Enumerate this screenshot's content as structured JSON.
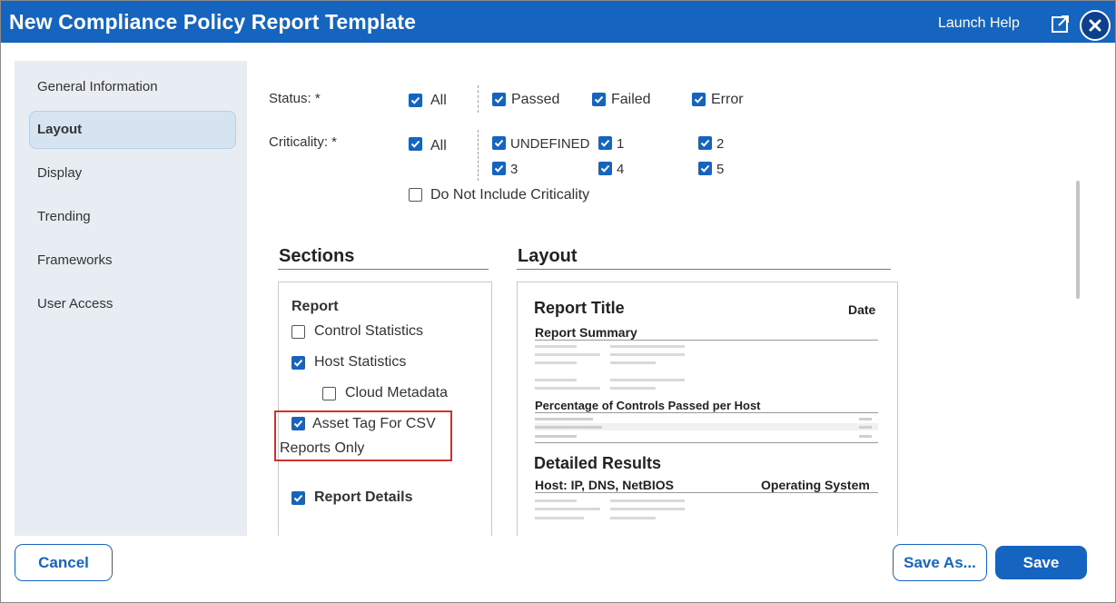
{
  "window": {
    "title": "New Compliance Policy Report Template",
    "launch_help": "Launch Help"
  },
  "sidebar": {
    "items": [
      {
        "label": "General Information",
        "active": false
      },
      {
        "label": "Layout",
        "active": true
      },
      {
        "label": "Display",
        "active": false
      },
      {
        "label": "Trending",
        "active": false
      },
      {
        "label": "Frameworks",
        "active": false
      },
      {
        "label": "User Access",
        "active": false
      }
    ]
  },
  "filters": {
    "status": {
      "label": "Status: *",
      "options": [
        {
          "label": "All",
          "checked": true
        },
        {
          "label": "Passed",
          "checked": true
        },
        {
          "label": "Failed",
          "checked": true
        },
        {
          "label": "Error",
          "checked": true
        }
      ]
    },
    "criticality": {
      "label": "Criticality: *",
      "options": [
        {
          "label": "All",
          "checked": true
        },
        {
          "label": "UNDEFINED",
          "checked": true
        },
        {
          "label": "1",
          "checked": true
        },
        {
          "label": "2",
          "checked": true
        },
        {
          "label": "3",
          "checked": true
        },
        {
          "label": "4",
          "checked": true
        },
        {
          "label": "5",
          "checked": true
        }
      ],
      "exclude": {
        "label": "Do Not Include Criticality",
        "checked": false
      }
    }
  },
  "sections": {
    "heading": "Sections",
    "group_label": "Report",
    "items": [
      {
        "label": "Control Statistics",
        "checked": false
      },
      {
        "label": "Host Statistics",
        "checked": true
      },
      {
        "label": "Cloud Metadata",
        "checked": false
      },
      {
        "label": "Asset Tag For CSV",
        "label_cont": "Reports Only",
        "checked": true
      },
      {
        "label": "Report Details",
        "checked": true
      }
    ]
  },
  "layout_preview": {
    "heading": "Layout",
    "report_title": "Report Title",
    "date": "Date",
    "report_summary": "Report Summary",
    "percentage_heading": "Percentage of Controls Passed per Host",
    "detailed_results": "Detailed Results",
    "host_col": "Host: IP, DNS, NetBIOS",
    "os_col": "Operating System"
  },
  "footer": {
    "cancel": "Cancel",
    "save_as": "Save As...",
    "save": "Save"
  },
  "colors": {
    "brand": "#1565c0",
    "highlight": "#d32f2f"
  }
}
